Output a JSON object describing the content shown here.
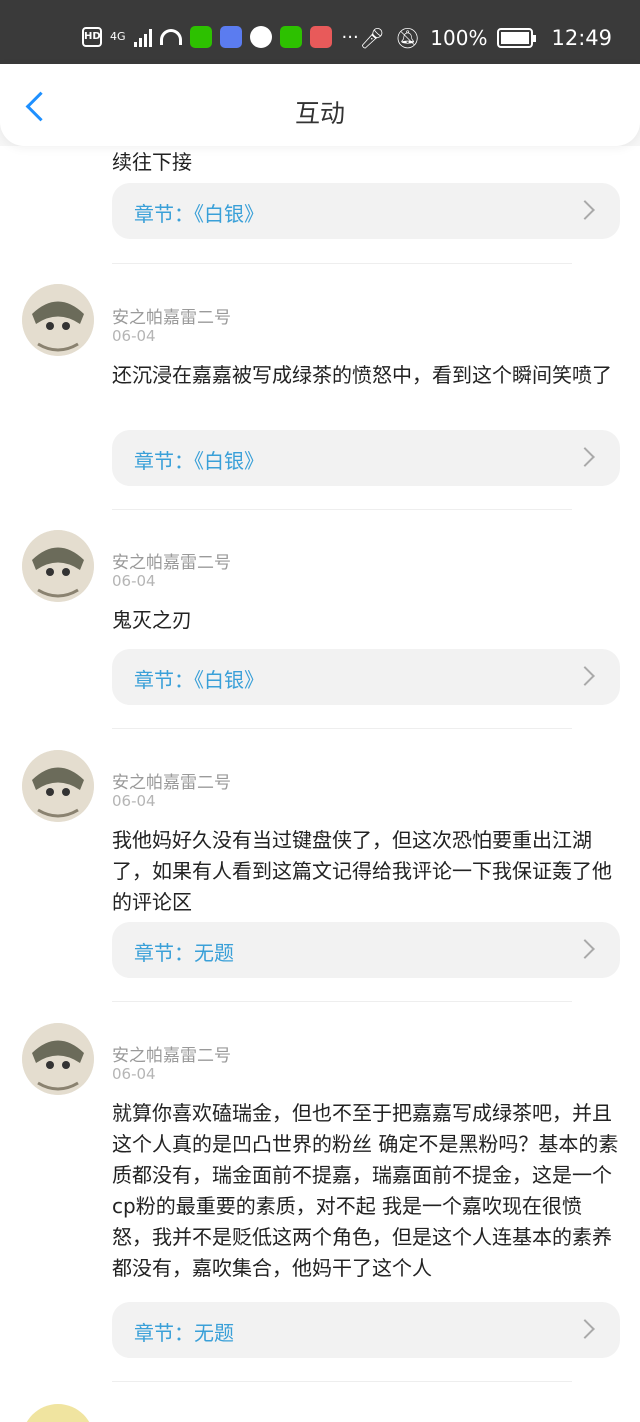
{
  "status_bar": {
    "hd": "HD",
    "network": "4G",
    "more": "···",
    "battery": "100%",
    "time": "12:49"
  },
  "header": {
    "title": "互动"
  },
  "partial_text": "续往下接",
  "comments": [
    {
      "chapter": "章节：《白银》"
    },
    {
      "user": "安之帕嘉雷二号",
      "date": "06-04",
      "text": "还沉浸在嘉嘉被写成绿茶的愤怒中，看到这个瞬间笑喷了",
      "chapter": "章节：《白银》"
    },
    {
      "user": "安之帕嘉雷二号",
      "date": "06-04",
      "text": "鬼灭之刃",
      "chapter": "章节：《白银》"
    },
    {
      "user": "安之帕嘉雷二号",
      "date": "06-04",
      "text": "我他妈好久没有当过键盘侠了，但这次恐怕要重出江湖了，如果有人看到这篇文记得给我评论一下我保证轰了他的评论区",
      "chapter": "章节：无题"
    },
    {
      "user": "安之帕嘉雷二号",
      "date": "06-04",
      "text": "就算你喜欢磕瑞金，但也不至于把嘉嘉写成绿茶吧，并且这个人真的是凹凸世界的粉丝 确定不是黑粉吗？基本的素质都没有，瑞金面前不提嘉，瑞嘉面前不提金，这是一个cp粉的最重要的素质，对不起 我是一个嘉吹现在很愤怒，我并不是贬低这两个角色，但是这个人连基本的素养都没有，嘉吹集合，他妈干了这个人",
      "chapter": "章节：无题"
    }
  ],
  "colors": {
    "accent": "#1e90ff",
    "chapter_text": "#3aa0d8"
  }
}
